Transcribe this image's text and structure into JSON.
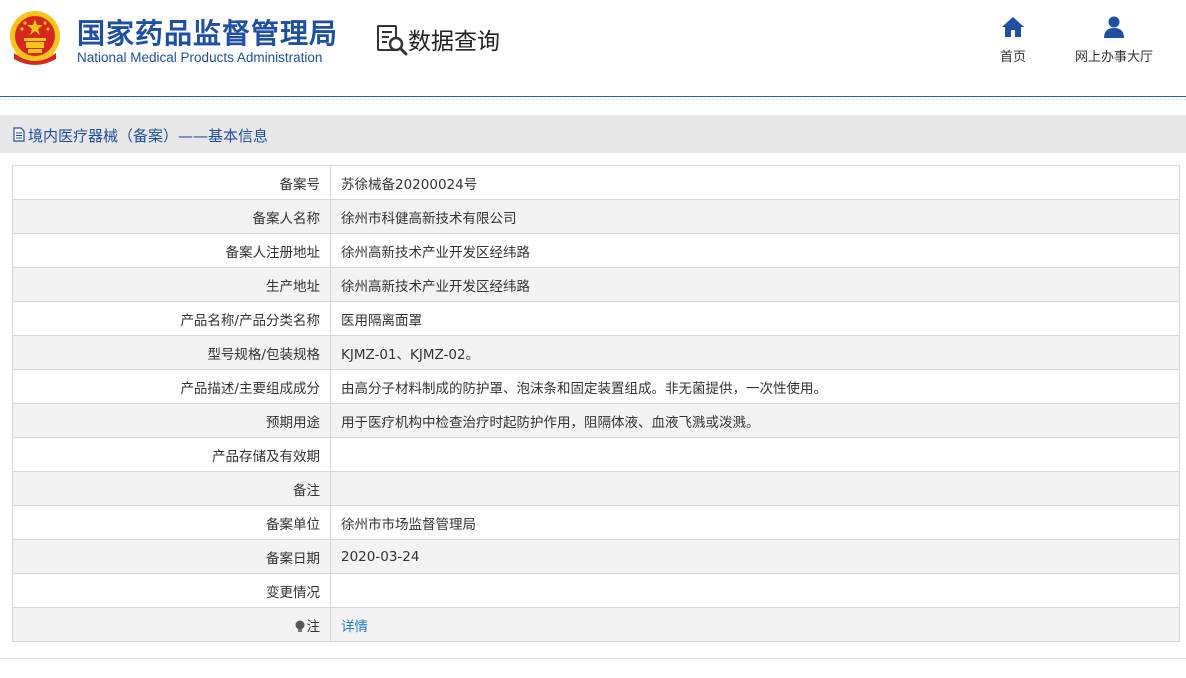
{
  "header": {
    "brand_cn": "国家药品监督管理局",
    "brand_en": "National Medical Products Administration",
    "query_title": "数据查询",
    "nav": [
      {
        "label": "首页",
        "icon": "home-icon"
      },
      {
        "label": "网上办事大厅",
        "icon": "user-icon"
      }
    ]
  },
  "section": {
    "title": "境内医疗器械（备案）——基本信息"
  },
  "rows": [
    {
      "key": "备案号",
      "value": "苏徐械备20200024号"
    },
    {
      "key": "备案人名称",
      "value": "徐州市科健高新技术有限公司"
    },
    {
      "key": "备案人注册地址",
      "value": "徐州高新技术产业开发区经纬路"
    },
    {
      "key": "生产地址",
      "value": "徐州高新技术产业开发区经纬路"
    },
    {
      "key": "产品名称/产品分类名称",
      "value": "医用隔离面罩"
    },
    {
      "key": "型号规格/包装规格",
      "value": "KJMZ-01、KJMZ-02。"
    },
    {
      "key": "产品描述/主要组成成分",
      "value": "由高分子材料制成的防护罩、泡沫条和固定装置组成。非无菌提供，一次性使用。"
    },
    {
      "key": "预期用途",
      "value": "用于医疗机构中检查治疗时起防护作用，阻隔体液、血液飞溅或泼溅。"
    },
    {
      "key": "产品存储及有效期",
      "value": ""
    },
    {
      "key": "备注",
      "value": ""
    },
    {
      "key": "备案单位",
      "value": "徐州市市场监督管理局"
    },
    {
      "key": "备案日期",
      "value": "2020-03-24"
    },
    {
      "key": "变更情况",
      "value": ""
    }
  ],
  "note": {
    "key": "注",
    "link": "详情"
  },
  "colors": {
    "brand_blue": "#1e4fa3",
    "link_blue": "#1a7ad8",
    "emblem_red": "#d7261e",
    "emblem_gold": "#f5c518"
  }
}
